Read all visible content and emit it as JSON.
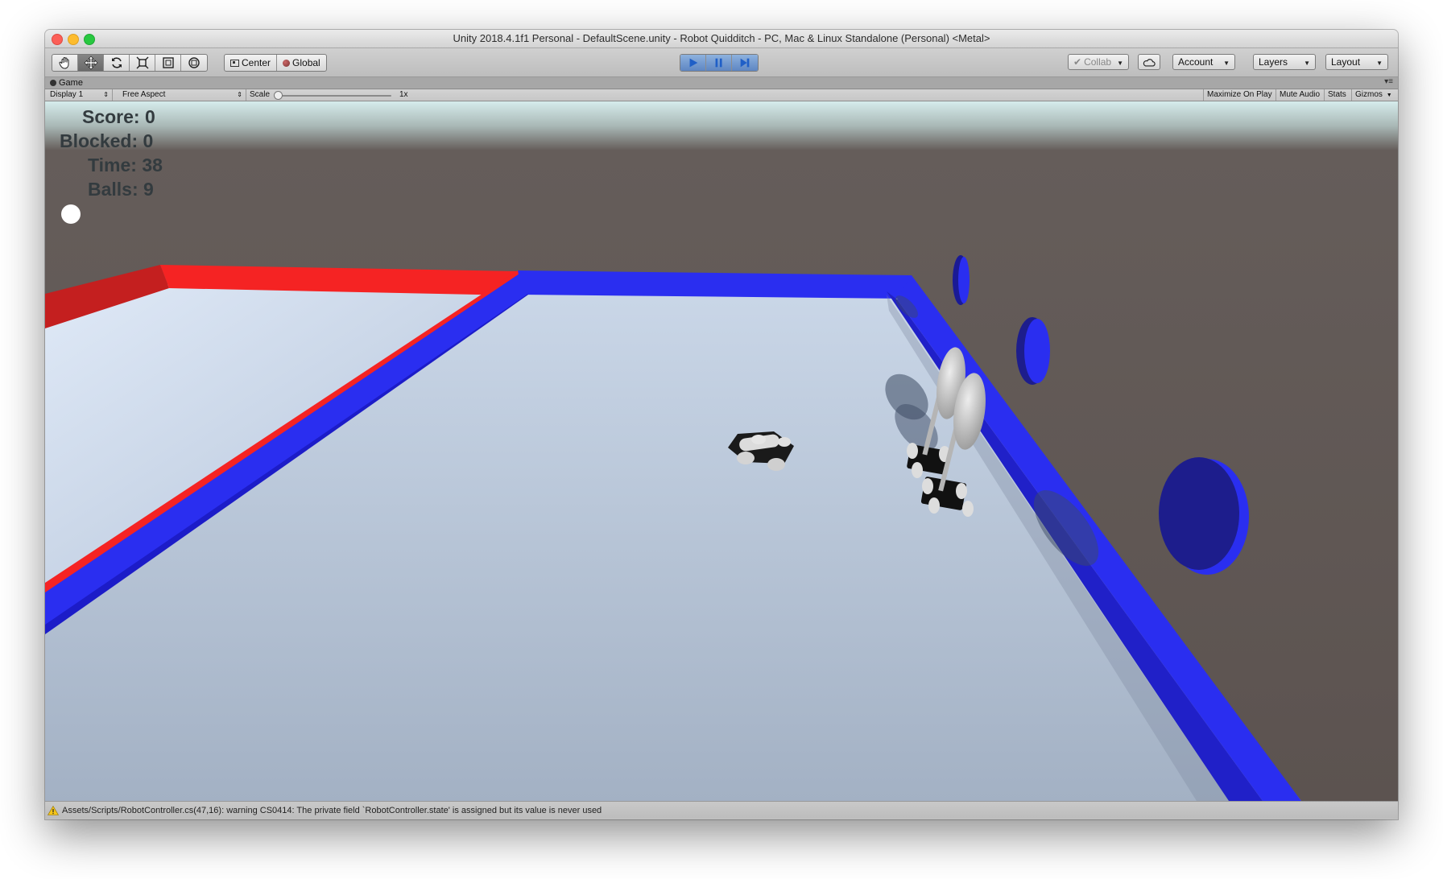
{
  "window": {
    "title": "Unity 2018.4.1f1 Personal - DefaultScene.unity - Robot Quidditch - PC, Mac & Linux Standalone (Personal) <Metal>"
  },
  "toolbar": {
    "tools": [
      "hand-tool",
      "move-tool",
      "rotate-tool",
      "scale-tool",
      "rect-tool",
      "transform-tool"
    ],
    "pivot_mode": "Center",
    "pivot_rotation": "Global",
    "collab": "Collab",
    "account": "Account",
    "layers": "Layers",
    "layout": "Layout"
  },
  "tab": {
    "label": "Game"
  },
  "game_toolbar": {
    "display": "Display 1",
    "aspect": "Free Aspect",
    "scale_label": "Scale",
    "scale_value": "1x",
    "maximize": "Maximize On Play",
    "mute": "Mute Audio",
    "stats": "Stats",
    "gizmos": "Gizmos"
  },
  "hud": {
    "score": "Score: 0",
    "blocked": "Blocked: 0",
    "time": "Time: 38",
    "balls": "Balls: 9"
  },
  "colors": {
    "red_wall": "#f52323",
    "blue_wall": "#2a2ef0",
    "goal_blue": "#1d1d8c",
    "floor": "#b7c6d9",
    "sky": "#5d5552"
  },
  "status": {
    "message": "Assets/Scripts/RobotController.cs(47,16): warning CS0414: The private field `RobotController.state' is assigned but its value is never used"
  }
}
